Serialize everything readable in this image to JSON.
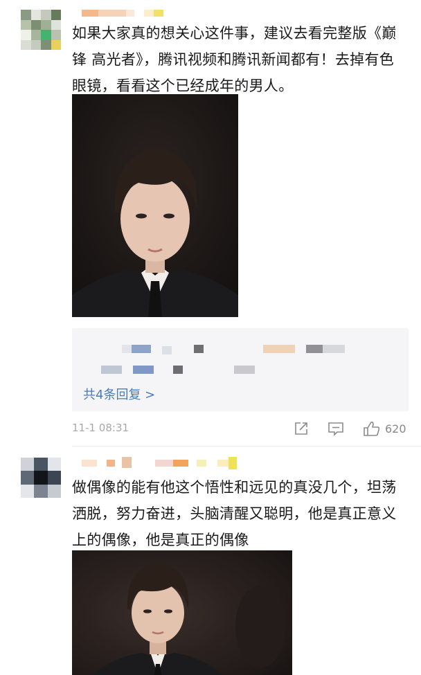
{
  "comments": [
    {
      "text": "如果大家真的想关心这件事，建议去看完整版《巅锋 高光者》，腾讯视频和腾讯新闻都有！去掉有色眼镜，看看这个已经成年的男人。",
      "replies": {
        "more_label": "共4条回复 >"
      },
      "timestamp": "11-1 08:31",
      "likes": "620"
    },
    {
      "text": "做偶像的能有他这个悟性和远见的真没几个，坦荡洒脱，努力奋进，头脑清醒又聪明，他是真正意义上的偶像，他是真正的偶像"
    }
  ],
  "icons": {
    "share": "share-icon",
    "comment": "comment-icon",
    "like": "thumbs-up-icon"
  },
  "colors": {
    "link": "#4a7bb8",
    "meta": "#a8a8a8"
  }
}
